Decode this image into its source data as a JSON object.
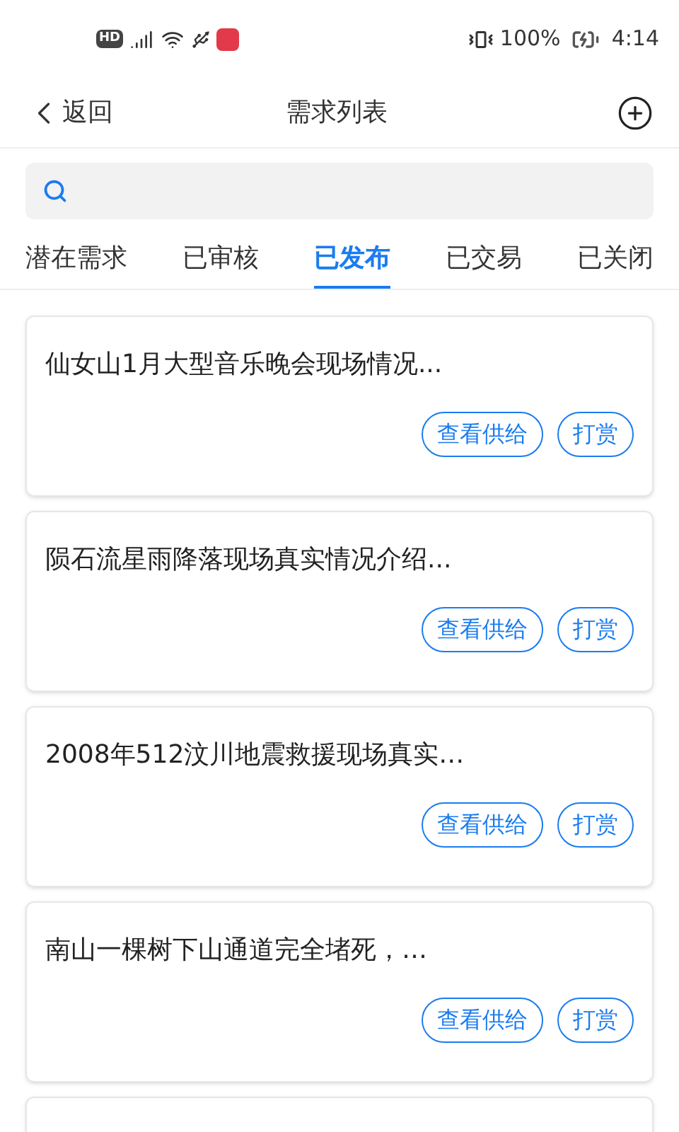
{
  "status_bar": {
    "hd": "HD",
    "battery": "100%",
    "time": "4:14"
  },
  "header": {
    "back": "返回",
    "title": "需求列表"
  },
  "tabs": [
    {
      "label": "潜在需求",
      "selected": false
    },
    {
      "label": "已审核",
      "selected": false
    },
    {
      "label": "已发布",
      "selected": true
    },
    {
      "label": "已交易",
      "selected": false
    },
    {
      "label": "已关闭",
      "selected": false
    }
  ],
  "cards": [
    {
      "title": "仙女山1月大型音乐晚会现场情况...",
      "buttons": [
        "查看供给",
        "打赏"
      ]
    },
    {
      "title": "陨石流星雨降落现场真实情况介绍...",
      "buttons": [
        "查看供给",
        "打赏"
      ]
    },
    {
      "title": "2008年512汶川地震救援现场真实…",
      "buttons": [
        "查看供给",
        "打赏"
      ]
    },
    {
      "title": "南山一棵树下山通道完全堵死，…",
      "buttons": [
        "查看供给",
        "打赏"
      ]
    }
  ]
}
